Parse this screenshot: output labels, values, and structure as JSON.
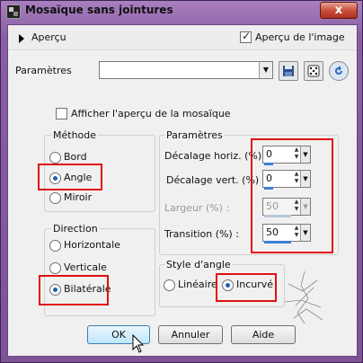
{
  "window": {
    "title": "Mosaïque sans jointures",
    "close_label": "x"
  },
  "top": {
    "apercu_label": "Aperçu",
    "apercu_image_label": "Aperçu de l'image",
    "apercu_image_checked": true
  },
  "presets": {
    "label": "Paramètres",
    "value": ""
  },
  "mosaic_preview_label": "Afficher l'aperçu de la mosaïque",
  "methode": {
    "title": "Méthode",
    "options": [
      "Bord",
      "Angle",
      "Miroir"
    ],
    "selected": "Angle"
  },
  "direction": {
    "title": "Direction",
    "options": [
      "Horizontale",
      "Verticale",
      "Bilatérale"
    ],
    "selected": "Bilatérale"
  },
  "parametres": {
    "title": "Paramètres",
    "fields": [
      {
        "label": "Décalage horiz. (%) :",
        "value": "0",
        "enabled": true,
        "fill": 0.0
      },
      {
        "label": "Décalage vert. (%) :",
        "value": "0",
        "enabled": true,
        "fill": 0.0
      },
      {
        "label": "Largeur (%) :",
        "value": "50",
        "enabled": false,
        "fill": 0.5
      },
      {
        "label": "Transition (%) :",
        "value": "50",
        "enabled": true,
        "fill": 0.5
      }
    ]
  },
  "style_angle": {
    "title": "Style d'angle",
    "options": [
      "Linéaire",
      "Incurvé"
    ],
    "selected": "Incurvé"
  },
  "buttons": {
    "ok": "OK",
    "cancel": "Annuler",
    "help": "Aide"
  }
}
